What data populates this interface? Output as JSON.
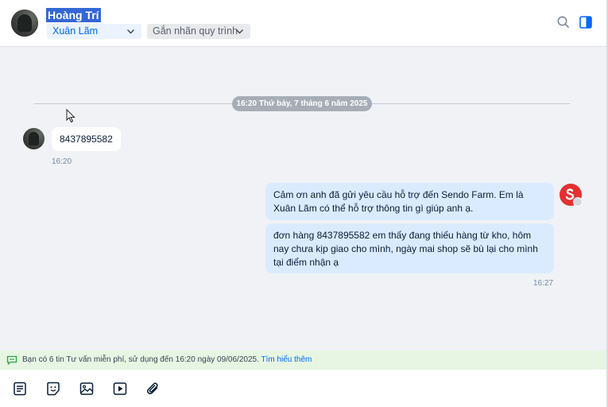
{
  "header": {
    "contact_name": "Hoàng Trí",
    "staff_select": "Xuân Lãm",
    "tag_select": "Gắn nhãn quy trình",
    "icons": [
      "search-icon",
      "panel-toggle-icon"
    ]
  },
  "conversation": {
    "date_separator": "16:20 Thứ bảy, 7 tháng 6 năm 2025",
    "incoming": {
      "text": "8437895582",
      "time": "16:20"
    },
    "outgoing": {
      "messages": [
        {
          "text": "Cảm ơn anh đã gửi yêu cầu hỗ trợ đến Sendo Farm. Em là Xuân Lãm có thể hỗ trợ thông tin gì giúp anh ạ."
        },
        {
          "text": "đơn hàng 8437895582 em thấy đang thiếu hàng từ kho, hôm nay chưa kịp giao cho mình, ngày mai shop sẽ bù lại cho mình tại điểm nhận ạ"
        }
      ],
      "time": "16:27"
    }
  },
  "promo": {
    "text": "Bạn có 6 tin Tư vấn miễn phí, sử dụng đến 16:20 ngày 09/06/2025.",
    "link": "Tìm hiểu thêm"
  },
  "toolbar": {
    "icons": [
      "quick-message-icon",
      "sticker-icon",
      "image-icon",
      "video-icon",
      "attachment-icon"
    ]
  },
  "colors": {
    "accent": "#0068ff",
    "outgoing_bubble": "#dbebff",
    "promo_bg": "#e6f6e3",
    "date_pill": "#a7adb7"
  }
}
